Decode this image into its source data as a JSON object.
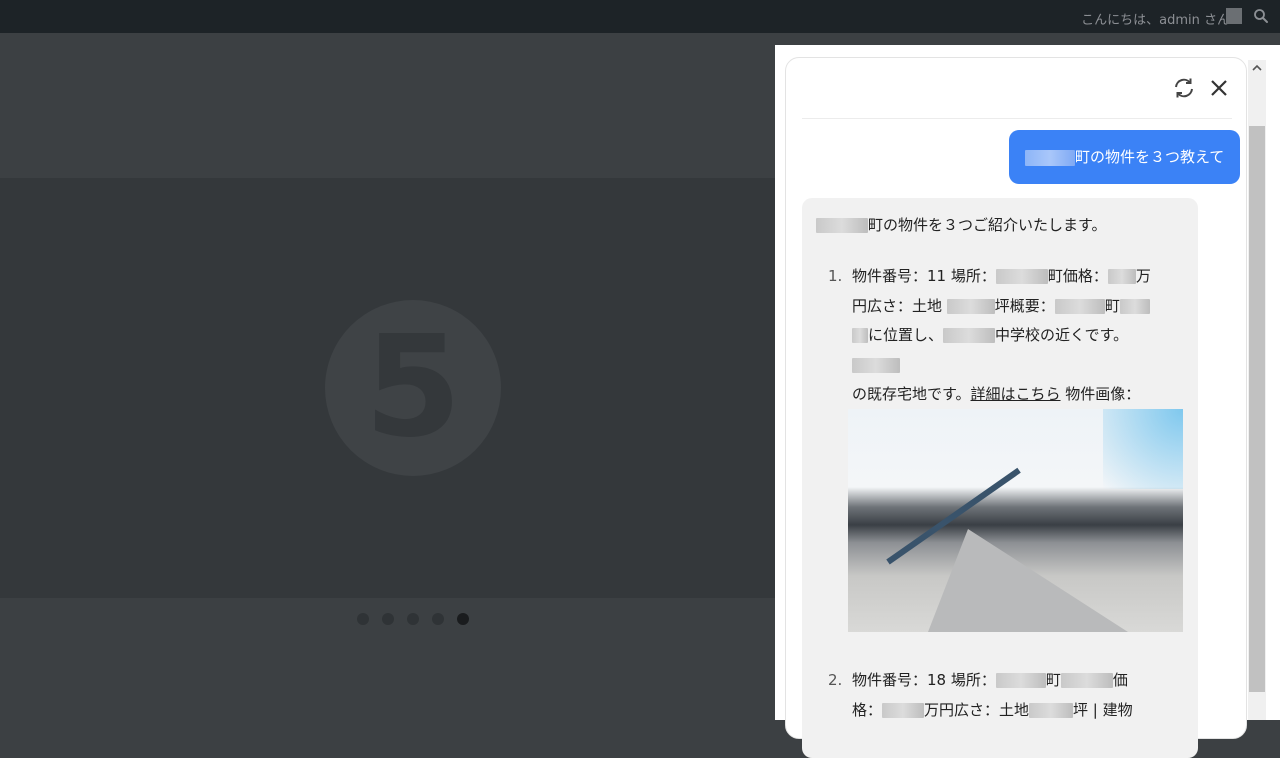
{
  "admin_bar": {
    "greeting": "こんにちは、admin さん",
    "icons": [
      "avatar",
      "search-icon"
    ]
  },
  "slider": {
    "slide_number": "5",
    "dots_count": 5,
    "active_dot": 5
  },
  "chat": {
    "header_icons": [
      "refresh-icon",
      "close-icon"
    ],
    "user_message": "町の物件を３つ教えて",
    "bot_intro": "町の物件を３つご紹介いたします。",
    "items": [
      {
        "number": "1.",
        "line1_a": "物件番号：11 場所：",
        "line1_b": "町価格：",
        "line1_c": "万",
        "line2_a": "円広さ：土地",
        "line2_b": "坪概要：",
        "line2_c": "町",
        "line3_a": "に位置し、",
        "line3_b": "中学校の近くです。",
        "line4_a": "の既存宅地です。",
        "link": "詳細はこちら",
        "line4_b": " 物件画像："
      },
      {
        "number": "2.",
        "line1_a": "物件番号：18 場所：",
        "line1_b": "町",
        "line1_c": "価",
        "line2_a": "格：",
        "line2_b": "万円広さ：土地",
        "line2_c": "坪 | 建物"
      }
    ]
  },
  "colors": {
    "user_bubble": "#3b82f6",
    "bot_bubble": "#f1f1f1",
    "admin_bar": "#1d2327"
  }
}
